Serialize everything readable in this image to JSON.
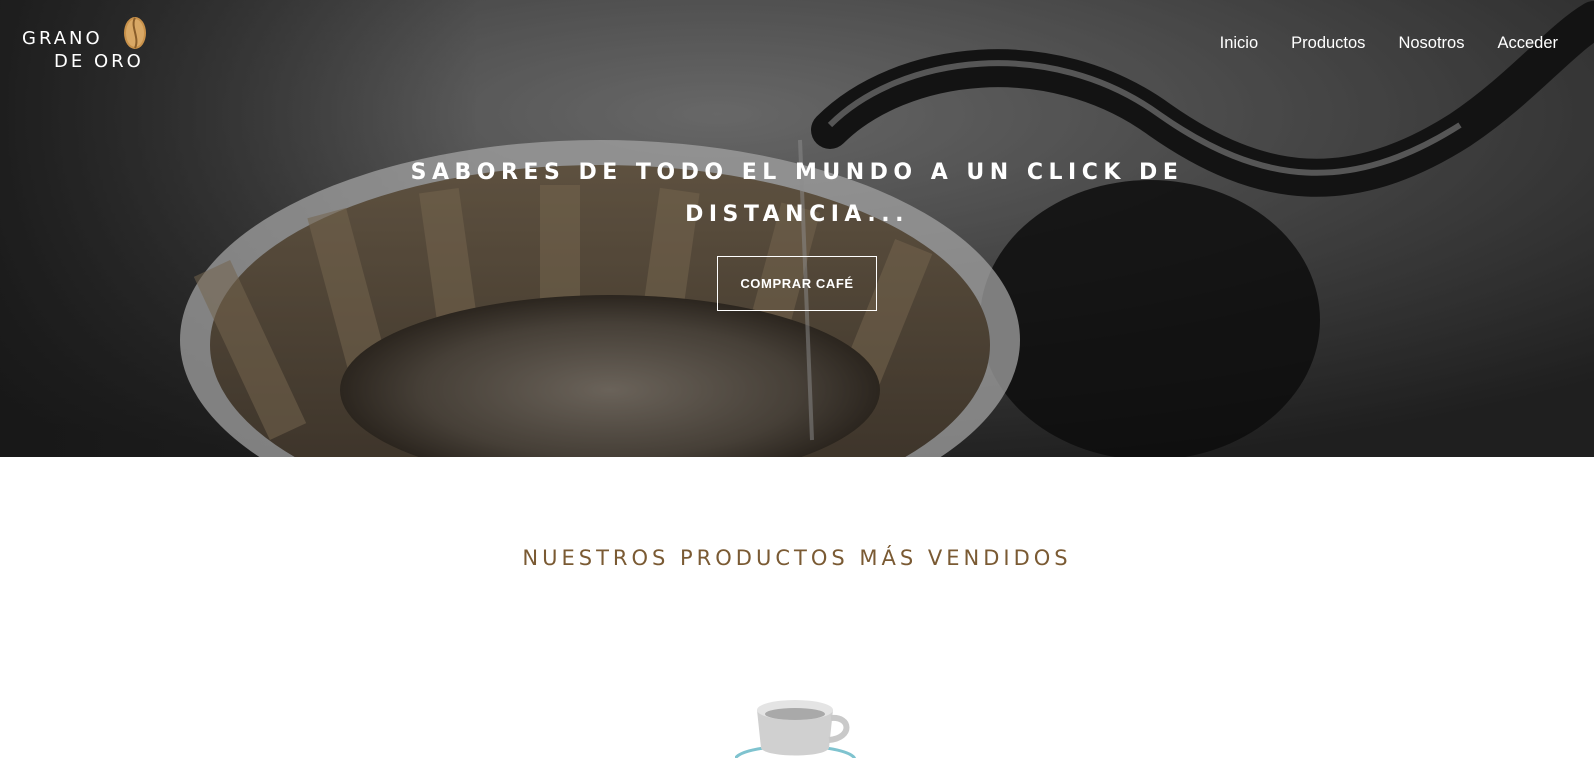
{
  "brand": {
    "logo_line1": "GRANO",
    "logo_line2": "DE ORO"
  },
  "nav": {
    "items": [
      {
        "label": "Inicio"
      },
      {
        "label": "Productos"
      },
      {
        "label": "Nosotros"
      },
      {
        "label": "Acceder"
      }
    ]
  },
  "hero": {
    "title": "SABORES DE TODO EL MUNDO A UN CLICK DE DISTANCIA...",
    "button_label": "COMPRAR CAFÉ"
  },
  "bestsellers": {
    "title": "NUESTROS PRODUCTOS MÁS VENDIDOS"
  },
  "colors": {
    "accent_brown": "#7a5a33",
    "bean_gold": "#c8914a",
    "hero_overlay": "#2b2b2b"
  }
}
